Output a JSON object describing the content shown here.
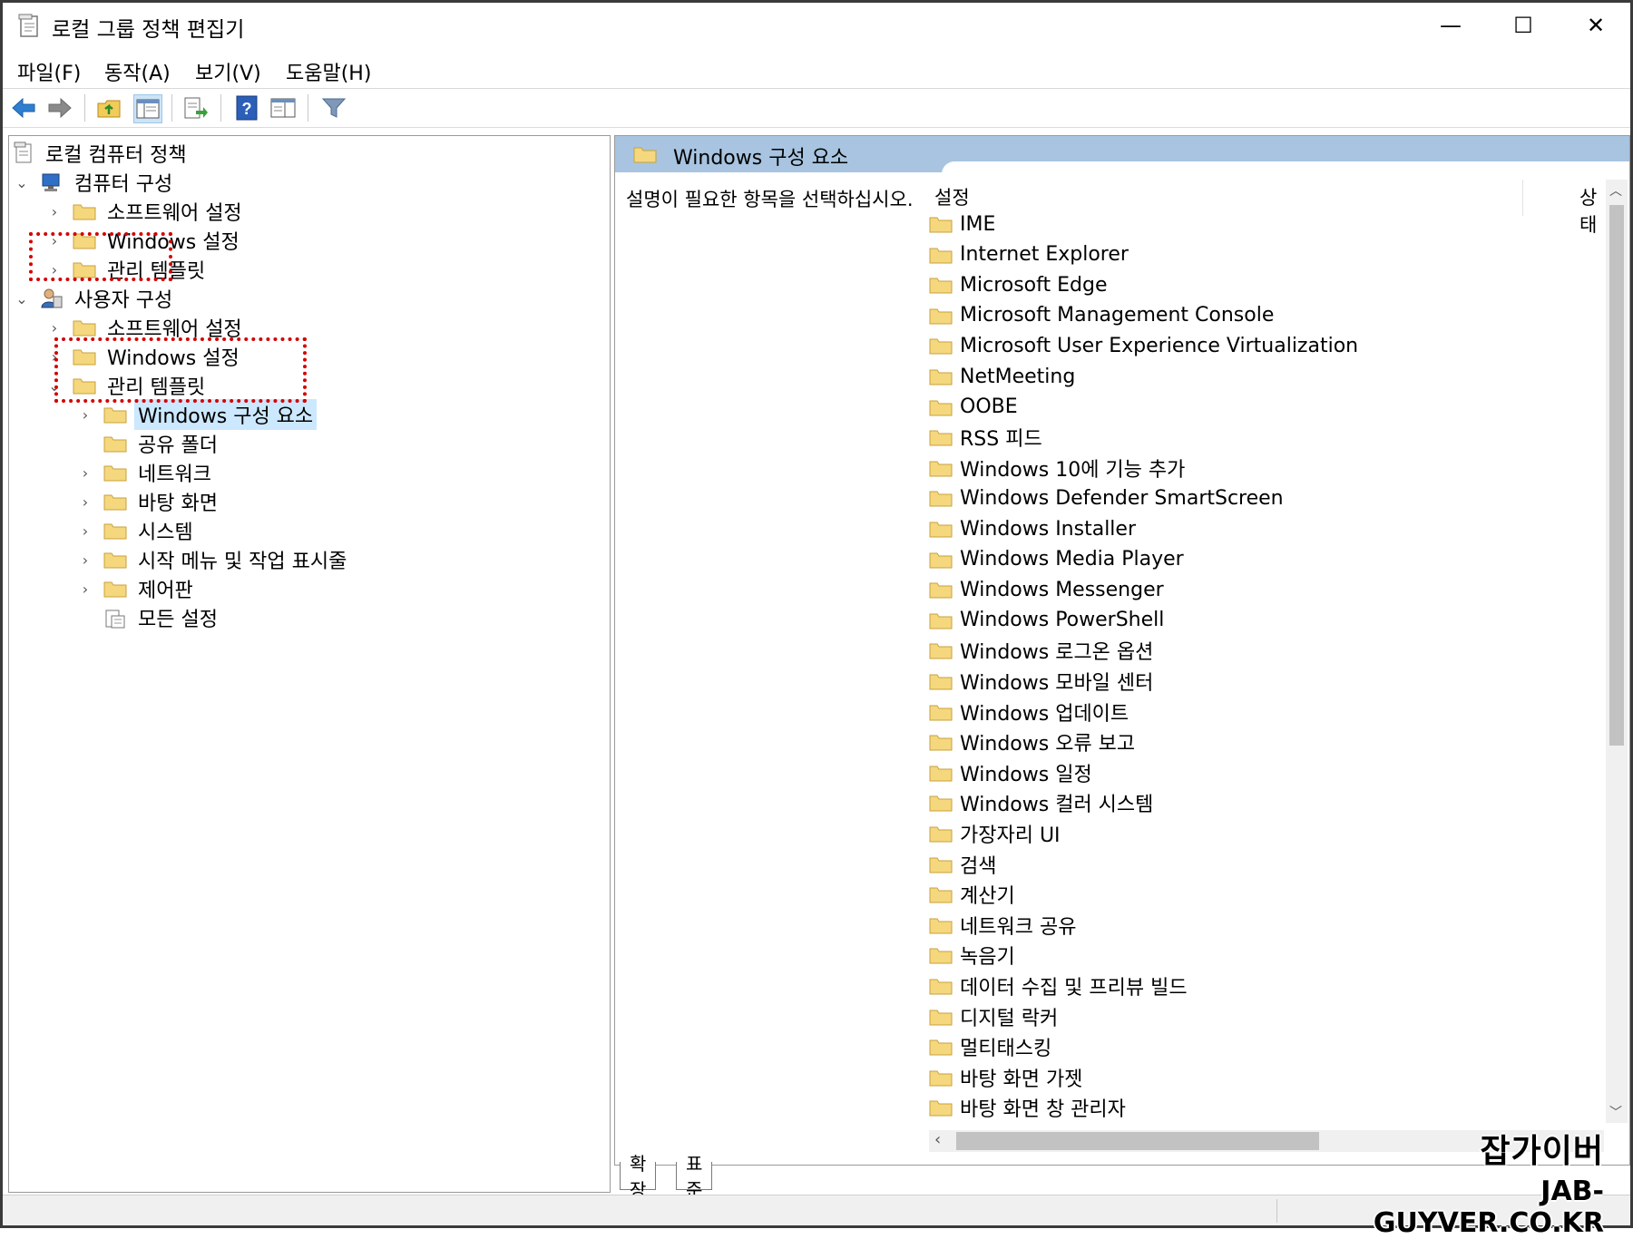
{
  "window": {
    "title": "로컬 그룹 정책 편집기",
    "minimize": "—",
    "maximize": "☐",
    "close": "✕"
  },
  "menu": {
    "file": "파일(F)",
    "action": "동작(A)",
    "view": "보기(V)",
    "help": "도움말(H)"
  },
  "toolbar": {
    "back": "back-arrow-icon",
    "forward": "forward-arrow-icon",
    "up": "up-folder-icon",
    "show_hide_tree": "console-tree-icon",
    "export": "export-list-icon",
    "help": "help-icon",
    "properties": "properties-pane-icon",
    "filter": "filter-icon"
  },
  "tree": {
    "root": "로컬 컴퓨터 정책",
    "computer_config": "컴퓨터 구성",
    "cc_software": "소프트웨어 설정",
    "cc_windows": "Windows 설정",
    "cc_admin": "관리 템플릿",
    "user_config": "사용자 구성",
    "uc_software": "소프트웨어 설정",
    "uc_windows": "Windows 설정",
    "uc_admin": "관리 템플릿",
    "windows_components": "Windows 구성 요소",
    "shared_folders": "공유 폴더",
    "network": "네트워크",
    "desktop": "바탕 화면",
    "system": "시스템",
    "start_menu": "시작 메뉴 및 작업 표시줄",
    "control_panel": "제어판",
    "all_settings": "모든 설정"
  },
  "right": {
    "header_title": "Windows 구성 요소",
    "description": "설명이 필요한 항목을 선택하십시오.",
    "col_setting": "설정",
    "col_state": "상태",
    "items": [
      "IME",
      "Internet Explorer",
      "Microsoft Edge",
      "Microsoft Management Console",
      "Microsoft User Experience Virtualization",
      "NetMeeting",
      "OOBE",
      "RSS 피드",
      "Windows 10에 기능 추가",
      "Windows Defender SmartScreen",
      "Windows Installer",
      "Windows Media Player",
      "Windows Messenger",
      "Windows PowerShell",
      "Windows 로그온 옵션",
      "Windows 모바일 센터",
      "Windows 업데이트",
      "Windows 오류 보고",
      "Windows 일정",
      "Windows 컬러 시스템",
      "가장자리 UI",
      "검색",
      "계산기",
      "네트워크 공유",
      "녹음기",
      "데이터 수집 및 프리뷰 빌드",
      "디지털 락커",
      "멀티태스킹",
      "바탕 화면 가젯",
      "바탕 화면 창 관리자"
    ]
  },
  "tabs": {
    "extended": "확장",
    "standard": "표준"
  },
  "watermark": {
    "line1": "잡가이버",
    "line2": "JAB-GUYVER.CO.KR"
  },
  "colors": {
    "header_blue": "#a8c4e0",
    "selection": "#cce8ff",
    "highlight_box": "#d40000",
    "folder": "#f5d77e"
  }
}
